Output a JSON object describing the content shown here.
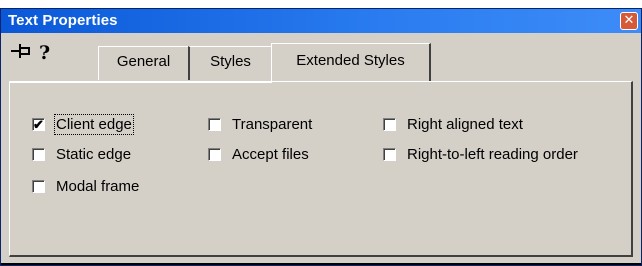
{
  "window": {
    "title": "Text Properties"
  },
  "tabs": [
    "General",
    "Styles",
    "Extended Styles"
  ],
  "checkboxes": [
    {
      "label": "Client edge",
      "checked": true
    },
    {
      "label": "Static edge",
      "checked": false
    },
    {
      "label": "Modal frame",
      "checked": false
    },
    {
      "label": "Transparent",
      "checked": false
    },
    {
      "label": "Accept files",
      "checked": false
    },
    {
      "label": "Right aligned text",
      "checked": false
    },
    {
      "label": "Right-to-left reading order",
      "checked": false
    }
  ],
  "icons": {
    "pin": "pushpin-icon",
    "help": "help-icon",
    "close": "close-icon",
    "check": "checkmark-icon"
  },
  "colors": {
    "titlebar": "#0a58d8",
    "dialog": "#d4d0c8",
    "close": "#d65a3a"
  }
}
